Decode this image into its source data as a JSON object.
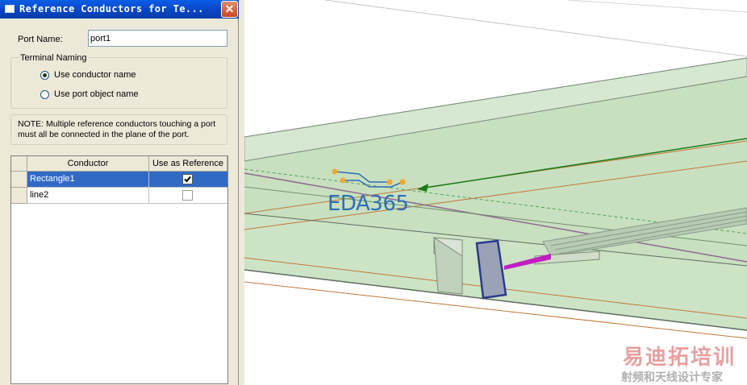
{
  "dialog": {
    "title": "Reference Conductors for Te...",
    "close_glyph": "✕",
    "port_name_label": "Port Name:",
    "port_name_value": "port1",
    "terminal_naming": {
      "legend": "Terminal Naming",
      "options": [
        "Use conductor name",
        "Use port object name"
      ],
      "selected": 0
    },
    "note": "NOTE: Multiple reference conductors touching a port must all be connected in the plane of the port.",
    "grid": {
      "columns": [
        "Conductor",
        "Use as Reference"
      ],
      "rows": [
        {
          "conductor": "Rectangle1",
          "use_as_reference": true,
          "selected": true
        },
        {
          "conductor": "line2",
          "use_as_reference": false,
          "selected": false
        }
      ]
    }
  },
  "viewport": {
    "logo": "EDA365",
    "watermark_title": "易迪拓培训",
    "watermark_subtitle": "射频和天线设计专家"
  },
  "colors": {
    "title_bar": "#0a5fe6",
    "selection": "#316ac5",
    "dialog_bg": "#ece9d8",
    "board_green": "#c8e0c0",
    "arrow_green": "#1a7a1a",
    "logo_blue": "#2e6fb8",
    "port_magenta": "#c020c0"
  }
}
